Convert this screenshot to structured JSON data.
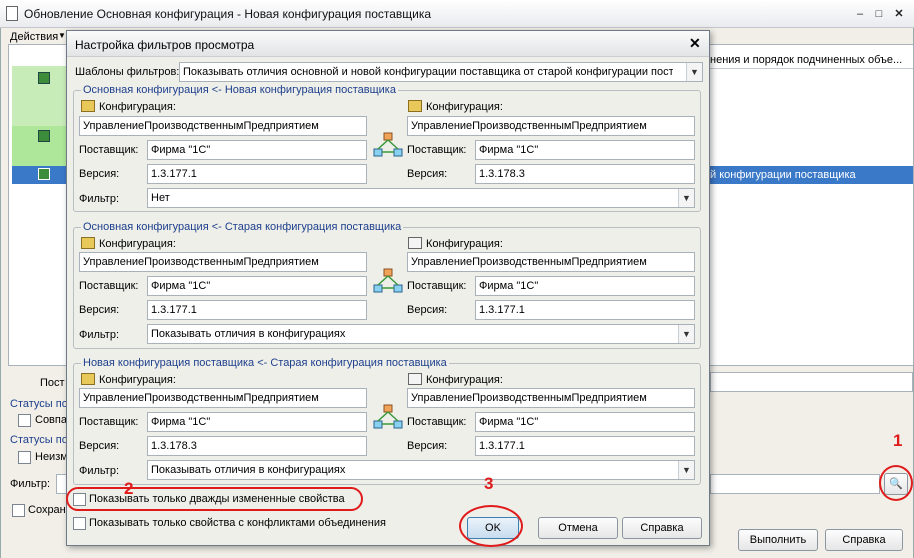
{
  "main": {
    "title": "Обновление Основная конфигурация - Новая конфигурация поставщика",
    "actions_label": "Действия",
    "header_right": "нения и порядок подчиненных объе...",
    "selected_row_text": "й конфигурации поставщика",
    "post_label": "Пост",
    "statuses1_label": "Статусы по",
    "match_checkbox": "Совпа",
    "statuses2_label": "Статусы по",
    "unchanged_checkbox": "Неизм",
    "filter_label": "Фильтр:",
    "save_checkbox": "Сохран",
    "run_button": "Выполнить",
    "help_button": "Справка"
  },
  "dialog": {
    "title": "Настройка фильтров просмотра",
    "templates_label": "Шаблоны фильтров:",
    "templates_value": "Показывать отличия основной и новой конфигурации поставщика от старой конфигурации постав",
    "groups": [
      {
        "title": "Основная конфигурация <- Новая конфигурация поставщика",
        "left": {
          "config_label": "Конфигурация:",
          "config_value": "УправлениеПроизводственнымПредприятием",
          "vendor_label": "Поставщик:",
          "vendor_value": "Фирма \"1С\"",
          "version_label": "Версия:",
          "version_value": "1.3.177.1"
        },
        "right": {
          "config_label": "Конфигурация:",
          "config_value": "УправлениеПроизводственнымПредприятием",
          "vendor_label": "Поставщик:",
          "vendor_value": "Фирма \"1С\"",
          "version_label": "Версия:",
          "version_value": "1.3.178.3"
        },
        "filter_label": "Фильтр:",
        "filter_value": "Нет"
      },
      {
        "title": "Основная конфигурация <- Старая конфигурация поставщика",
        "left": {
          "config_label": "Конфигурация:",
          "config_value": "УправлениеПроизводственнымПредприятием",
          "vendor_label": "Поставщик:",
          "vendor_value": "Фирма \"1С\"",
          "version_label": "Версия:",
          "version_value": "1.3.177.1"
        },
        "right": {
          "config_label": "Конфигурация:",
          "config_value": "УправлениеПроизводственнымПредприятием",
          "vendor_label": "Поставщик:",
          "vendor_value": "Фирма \"1С\"",
          "version_label": "Версия:",
          "version_value": "1.3.177.1"
        },
        "filter_label": "Фильтр:",
        "filter_value": "Показывать отличия в конфигурациях"
      },
      {
        "title": "Новая конфигурация поставщика <- Старая конфигурация поставщика",
        "left": {
          "config_label": "Конфигурация:",
          "config_value": "УправлениеПроизводственнымПредприятием",
          "vendor_label": "Поставщик:",
          "vendor_value": "Фирма \"1С\"",
          "version_label": "Версия:",
          "version_value": "1.3.178.3"
        },
        "right": {
          "config_label": "Конфигурация:",
          "config_value": "УправлениеПроизводственнымПредприятием",
          "vendor_label": "Поставщик:",
          "vendor_value": "Фирма \"1С\"",
          "version_label": "Версия:",
          "version_value": "1.3.177.1"
        },
        "filter_label": "Фильтр:",
        "filter_value": "Показывать отличия в конфигурациях"
      }
    ],
    "checkbox_twice_changed": "Показывать только дважды измененные свойства",
    "checkbox_conflicts": "Показывать только свойства с конфликтами объединения",
    "ok_button": "OK",
    "cancel_button": "Отмена",
    "help_button": "Справка"
  },
  "annotations": {
    "one": "1",
    "two": "2",
    "three": "3"
  },
  "colors": {
    "annotation_red": "#e01b1b",
    "selection_blue": "#3a78c8",
    "green_strip": "#b8e6a8"
  }
}
